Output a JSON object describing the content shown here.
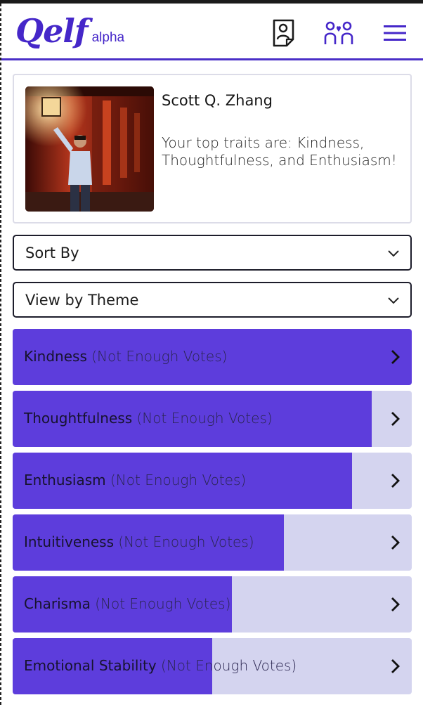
{
  "app": {
    "logo_text": "Qelf",
    "logo_tag": "alpha",
    "accent_color": "#5d3ddc",
    "track_color": "#d4d4ef"
  },
  "header": {
    "icons": [
      "profile-card-icon",
      "friends-icon",
      "hamburger-menu-icon"
    ]
  },
  "profile": {
    "name": "Scott Q. Zhang",
    "traits_summary": "Your top traits are: Kindness, Thoughtfulness, and Enthusiasm!"
  },
  "controls": {
    "sort_label": "Sort By",
    "view_label": "View by Theme"
  },
  "traits": [
    {
      "name": "Kindness",
      "status": "(Not Enough Votes)",
      "fill": 1.0
    },
    {
      "name": "Thoughtfulness",
      "status": "(Not Enough Votes)",
      "fill": 0.9
    },
    {
      "name": "Enthusiasm",
      "status": "(Not Enough Votes)",
      "fill": 0.85
    },
    {
      "name": "Intuitiveness",
      "status": "(Not Enough Votes)",
      "fill": 0.68
    },
    {
      "name": "Charisma",
      "status": "(Not Enough Votes)",
      "fill": 0.55
    },
    {
      "name": "Emotional Stability",
      "status": "(Not Enough Votes)",
      "fill": 0.5
    }
  ]
}
